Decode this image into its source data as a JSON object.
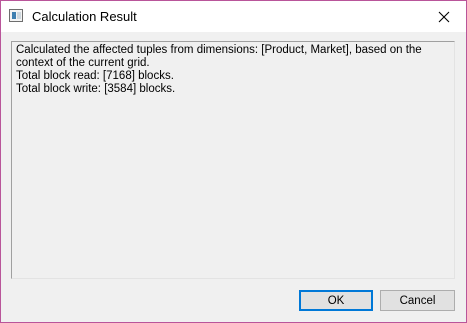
{
  "window": {
    "title": "Calculation Result",
    "accent_border_color": "#b9559a"
  },
  "titlebar": {
    "icon": "app-window-icon",
    "close_icon": "close-icon"
  },
  "message": {
    "lines": [
      "Calculated the affected tuples from dimensions: [Product, Market], based on the context of the current grid.",
      "Total block read: [7168] blocks.",
      "Total block write: [3584] blocks."
    ]
  },
  "buttons": {
    "ok_label": "OK",
    "cancel_label": "Cancel",
    "default_focus_color": "#0078d7"
  }
}
